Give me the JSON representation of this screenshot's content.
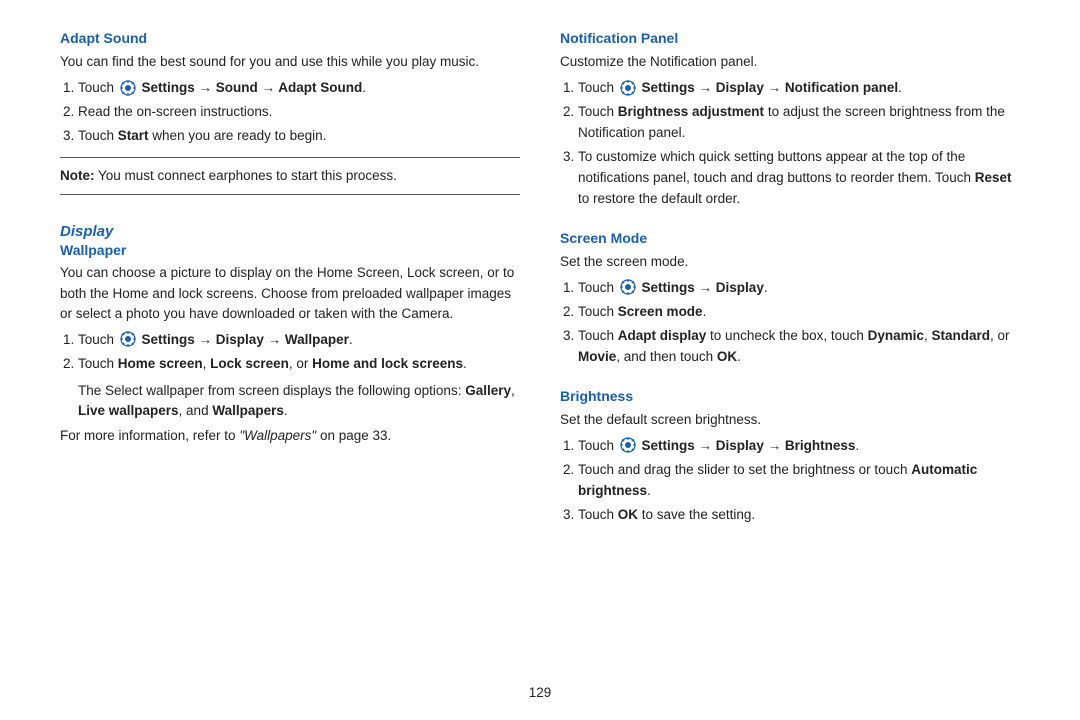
{
  "page": {
    "number": "129"
  },
  "left_column": {
    "adapt_sound": {
      "title": "Adapt Sound",
      "paragraph1": "You can find the best sound for you and use this while you play music.",
      "steps": [
        {
          "html": "Touch <settings-icon/> <b>Settings → Sound → Adapt Sound</b>."
        },
        {
          "html": "Read the on-screen instructions."
        },
        {
          "html": "Touch <b>Start</b> when you are ready to begin."
        }
      ],
      "note": "<b>Note:</b> You must connect earphones to start this process."
    },
    "display": {
      "title": "Display",
      "wallpaper": {
        "title": "Wallpaper",
        "paragraph1": "You can choose a picture to display on the Home Screen, Lock screen, or to both the Home and lock screens. Choose from preloaded wallpaper images or select a photo you have downloaded or taken with the Camera.",
        "steps": [
          {
            "html": "Touch <settings-icon/> <b>Settings → Display → Wallpaper</b>."
          },
          {
            "html": "Touch <b>Home screen</b>, <b>Lock screen</b>, or <b>Home and lock screens</b>."
          }
        ],
        "sub_paragraph": "The Select wallpaper from screen displays the following options: <b>Gallery</b>, <b>Live wallpapers</b>, and <b>Wallpapers</b>.",
        "footer": "For more information, refer to <i>\"Wallpapers\"</i> on page 33."
      }
    }
  },
  "right_column": {
    "notification_panel": {
      "title": "Notification Panel",
      "paragraph1": "Customize the Notification panel.",
      "steps": [
        {
          "html": "Touch <settings-icon/> <b>Settings → Display → Notification panel</b>."
        },
        {
          "html": "Touch <b>Brightness adjustment</b> to adjust the screen brightness from the Notification panel."
        },
        {
          "html": "To customize which quick setting buttons appear at the top of the notifications panel, touch and drag buttons to reorder them. Touch <b>Reset</b> to restore the default order."
        }
      ]
    },
    "screen_mode": {
      "title": "Screen Mode",
      "paragraph1": "Set the screen mode.",
      "steps": [
        {
          "html": "Touch <settings-icon/> <b>Settings → Display</b>."
        },
        {
          "html": "Touch <b>Screen mode</b>."
        },
        {
          "html": "Touch <b>Adapt display</b> to uncheck the box, touch <b>Dynamic</b>, <b>Standard</b>, or <b>Movie</b>, and then touch <b>OK</b>."
        }
      ]
    },
    "brightness": {
      "title": "Brightness",
      "paragraph1": "Set the default screen brightness.",
      "steps": [
        {
          "html": "Touch <settings-icon/> <b>Settings → Display → Brightness</b>."
        },
        {
          "html": "Touch and drag the slider to set the brightness or touch <b>Automatic brightness</b>."
        },
        {
          "html": "Touch <b>OK</b> to save the setting."
        }
      ]
    }
  }
}
